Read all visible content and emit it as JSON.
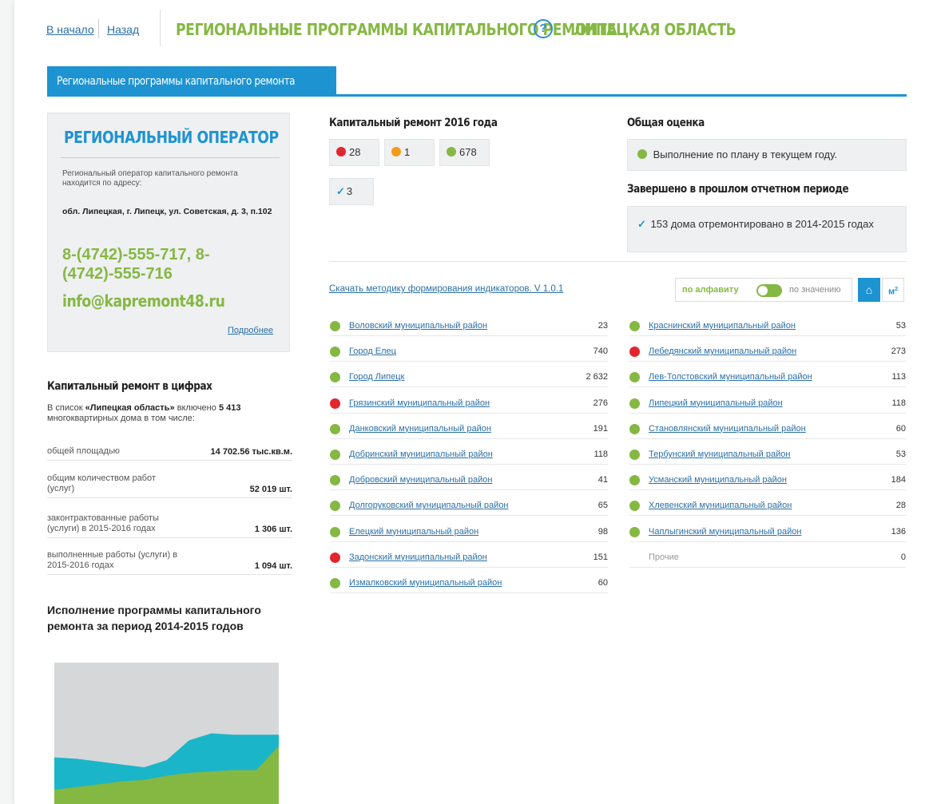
{
  "colors": {
    "green": "#85b843",
    "red": "#e2262d",
    "orange": "#f39b1c",
    "blue": "#1d93d2",
    "teal": "#1ab5c8",
    "chart_bg": "#d5d7d8"
  },
  "header": {
    "home_link": "В начало",
    "back_link": "Назад",
    "title": "РЕГИОНАЛЬНЫЕ ПРОГРАММЫ КАПИТАЛЬНОГО РЕМОНТА",
    "help_icon": "?",
    "region": "ЛИПЕЦКАЯ ОБЛАСТЬ"
  },
  "tab": {
    "label": "Региональные программы капитального ремонта"
  },
  "operator": {
    "title": "РЕГИОНАЛЬНЫЙ ОПЕРАТОР",
    "description": "Региональный оператор капитального ремонта находится по адресу:",
    "address": "обл. Липецкая, г. Липецк, ул. Советская, д. 3, п.102",
    "phone": "8-(4742)-555-717, 8-(4742)-555-716",
    "email": "info@kapremont48.ru",
    "more_link": "Подробнее"
  },
  "figures": {
    "title": "Капитальный ремонт в цифрах",
    "intro_prefix": "В список ",
    "intro_region": "«Липецкая область»",
    "intro_mid": " включено ",
    "intro_count": "5 413",
    "intro_suffix": " многоквартирных дома в том числе:",
    "rows": [
      {
        "label": "общей площадью",
        "value": "14 702.56 тыс.кв.м."
      },
      {
        "label": "общим количеством работ (услуг)",
        "value": "52 019 шт."
      },
      {
        "label": "законтрактованные работы (услуги) в 2015-2016 годах",
        "value": "1 306 шт."
      },
      {
        "label": "выполненные работы (услуги) в 2015-2016 годах",
        "value": "1 094 шт."
      }
    ]
  },
  "execution": {
    "title": "Исполнение программы капитального ремонта за период 2014-2015 годов"
  },
  "chart_data": {
    "type": "area",
    "title": "Исполнение программы капитального ремонта за период 2014-2015 годов",
    "xlabel": "",
    "ylabel": "",
    "x": [
      0,
      1,
      2,
      3,
      4,
      5,
      6,
      7,
      8,
      9,
      10
    ],
    "ylim": [
      0,
      100
    ],
    "series": [
      {
        "values": [
          33,
          32,
          30,
          28,
          26,
          31,
          45,
          50,
          49,
          49,
          49
        ]
      },
      {
        "values": [
          10,
          12,
          14,
          16,
          17,
          20,
          22,
          23,
          24,
          24,
          41
        ]
      }
    ]
  },
  "capital_2016": {
    "title": "Капитальный ремонт 2016 года",
    "red_count": "28",
    "orange_count": "1",
    "green_count": "678",
    "check_icon": "✓",
    "check_count": "3"
  },
  "overall": {
    "title": "Общая оценка",
    "status": "Выполнение по плану в текущем году."
  },
  "completed": {
    "title": "Завершено в прошлом отчетном периоде",
    "check_icon": "✓",
    "text": "153 дома отремонтировано в 2014-2015 годах"
  },
  "download_link": "Скачать методику формирования индикаторов. V 1.0.1",
  "sort": {
    "alpha": "по алфавиту",
    "by_value": "по значению",
    "house_icon": "⌂",
    "m2_label": "м",
    "m2_sup": "2"
  },
  "districts_left": [
    {
      "name": "Воловский муниципальный район",
      "value": "23",
      "status": "green"
    },
    {
      "name": "Город Елец",
      "value": "740",
      "status": "green"
    },
    {
      "name": "Город Липецк",
      "value": "2 632",
      "status": "green"
    },
    {
      "name": "Грязинский муниципальный район",
      "value": "276",
      "status": "red"
    },
    {
      "name": "Данковский муниципальный район",
      "value": "191",
      "status": "green"
    },
    {
      "name": "Добринский муниципальный район",
      "value": "118",
      "status": "green"
    },
    {
      "name": "Добровский муниципальный район",
      "value": "41",
      "status": "green"
    },
    {
      "name": "Долгоруковский муниципальный район",
      "value": "65",
      "status": "green"
    },
    {
      "name": "Елецкий муниципальный район",
      "value": "98",
      "status": "green"
    },
    {
      "name": "Задонский муниципальный район",
      "value": "151",
      "status": "red"
    },
    {
      "name": "Измалковский муниципальный район",
      "value": "60",
      "status": "green"
    }
  ],
  "districts_right": [
    {
      "name": "Краснинский муниципальный район",
      "value": "53",
      "status": "green"
    },
    {
      "name": "Лебедянский муниципальный район",
      "value": "273",
      "status": "red"
    },
    {
      "name": "Лев-Толстовский муниципальный район",
      "value": "113",
      "status": "green"
    },
    {
      "name": "Липецкий муниципальный район",
      "value": "118",
      "status": "green"
    },
    {
      "name": "Становлянский муниципальный район",
      "value": "60",
      "status": "green"
    },
    {
      "name": "Тербунский муниципальный район",
      "value": "53",
      "status": "green"
    },
    {
      "name": "Усманский муниципальный район",
      "value": "184",
      "status": "green"
    },
    {
      "name": "Хлевенский муниципальный район",
      "value": "28",
      "status": "green"
    },
    {
      "name": "Чаплыгинский муниципальный район",
      "value": "136",
      "status": "green"
    },
    {
      "name": "Прочие",
      "value": "0",
      "status": "none"
    }
  ]
}
